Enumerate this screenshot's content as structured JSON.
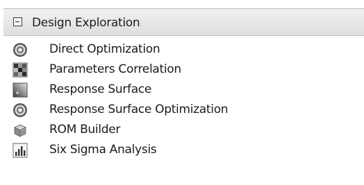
{
  "toolbox": {
    "section_title": "Design Exploration",
    "items": [
      {
        "label": "Direct Optimization",
        "icon": "target-icon"
      },
      {
        "label": "Parameters Correlation",
        "icon": "correlation-matrix-icon"
      },
      {
        "label": "Response Surface",
        "icon": "response-surface-icon"
      },
      {
        "label": "Response Surface Optimization",
        "icon": "target-icon"
      },
      {
        "label": "ROM Builder",
        "icon": "rom-builder-icon"
      },
      {
        "label": "Six Sigma Analysis",
        "icon": "bar-chart-icon"
      }
    ]
  }
}
